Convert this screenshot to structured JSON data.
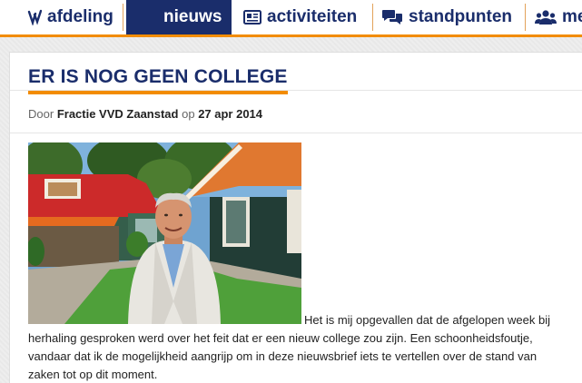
{
  "nav": {
    "items": [
      {
        "label": "afdeling",
        "icon": "vvd-logo-icon",
        "active": false
      },
      {
        "label": "nieuws",
        "icon": "newspaper-icon",
        "active": true
      },
      {
        "label": "activiteiten",
        "icon": "news-icon",
        "active": false
      },
      {
        "label": "standpunten",
        "icon": "speech-bubbles-icon",
        "active": false
      },
      {
        "label": "me",
        "icon": "people-icon",
        "active": false
      }
    ]
  },
  "article": {
    "title": "ER IS NOG GEEN COLLEGE",
    "meta": {
      "by_prefix": "Door",
      "author": "Fractie VVD Zaanstad",
      "date_prefix": "op",
      "date": "27 apr 2014"
    },
    "photo_alt": "Man in white jacket in front of a house with a red roof",
    "body_lines": [
      "Het is mij opgevallen dat de afgelopen week bij",
      "herhaling gesproken werd over het feit dat er een nieuw college zou zijn. Een schoonheidsfoutje,",
      "vandaar dat ik de mogelijkheid aangrijp om in deze nieuwsbrief iets te vertellen over de stand van",
      "zaken tot op dit moment."
    ]
  },
  "colors": {
    "navy": "#1a2d6b",
    "orange": "#f28c00"
  }
}
